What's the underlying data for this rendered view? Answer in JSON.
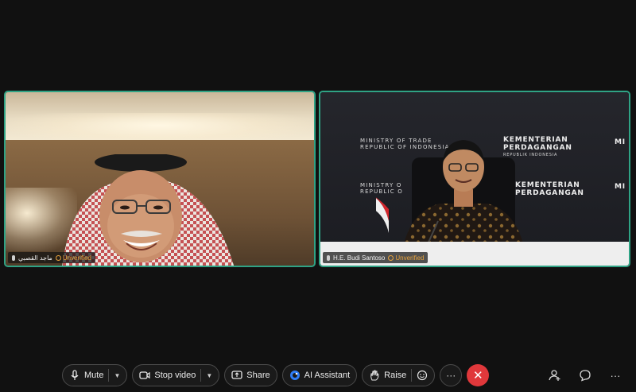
{
  "participants": [
    {
      "name": "ماجد القصبي",
      "status": "Unverified"
    },
    {
      "name": "H.E. Budi Santoso",
      "status": "Unverified"
    }
  ],
  "backdrop": {
    "line1": "MINISTRY OF TRADE",
    "line2": "REPUBLIC OF INDONESIA",
    "big1": "KEMENTERIAN",
    "big2": "PERDAGANGAN",
    "big_sub": "REPUBLIK INDONESIA",
    "line1_partial": "MINISTRY O",
    "line2_partial": "REPUBLIC O",
    "edge": "MI"
  },
  "toolbar": {
    "mute_label": "Mute",
    "stop_video_label": "Stop video",
    "share_label": "Share",
    "ai_assistant_label": "AI Assistant",
    "raise_label": "Raise",
    "more_label": "···",
    "end_label": "✕"
  },
  "colors": {
    "speaker_border": "#2fa385",
    "unverified": "#e8a33d",
    "end_call": "#e0383b",
    "ai_accent": "#2f7df6"
  }
}
